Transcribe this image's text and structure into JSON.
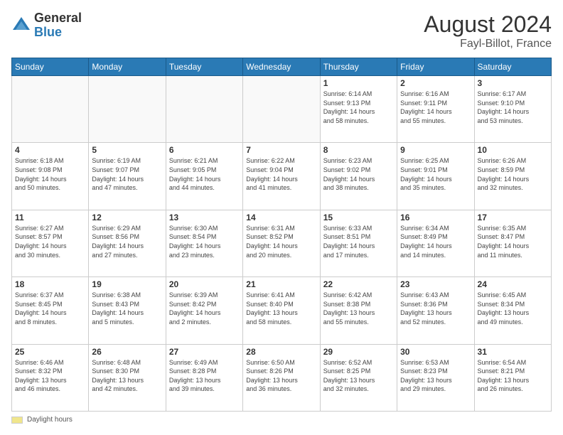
{
  "logo": {
    "general": "General",
    "blue": "Blue"
  },
  "header": {
    "month_year": "August 2024",
    "location": "Fayl-Billot, France"
  },
  "days_of_week": [
    "Sunday",
    "Monday",
    "Tuesday",
    "Wednesday",
    "Thursday",
    "Friday",
    "Saturday"
  ],
  "legend": {
    "label": "Daylight hours"
  },
  "weeks": [
    [
      {
        "day": "",
        "info": ""
      },
      {
        "day": "",
        "info": ""
      },
      {
        "day": "",
        "info": ""
      },
      {
        "day": "",
        "info": ""
      },
      {
        "day": "1",
        "info": "Sunrise: 6:14 AM\nSunset: 9:13 PM\nDaylight: 14 hours\nand 58 minutes."
      },
      {
        "day": "2",
        "info": "Sunrise: 6:16 AM\nSunset: 9:11 PM\nDaylight: 14 hours\nand 55 minutes."
      },
      {
        "day": "3",
        "info": "Sunrise: 6:17 AM\nSunset: 9:10 PM\nDaylight: 14 hours\nand 53 minutes."
      }
    ],
    [
      {
        "day": "4",
        "info": "Sunrise: 6:18 AM\nSunset: 9:08 PM\nDaylight: 14 hours\nand 50 minutes."
      },
      {
        "day": "5",
        "info": "Sunrise: 6:19 AM\nSunset: 9:07 PM\nDaylight: 14 hours\nand 47 minutes."
      },
      {
        "day": "6",
        "info": "Sunrise: 6:21 AM\nSunset: 9:05 PM\nDaylight: 14 hours\nand 44 minutes."
      },
      {
        "day": "7",
        "info": "Sunrise: 6:22 AM\nSunset: 9:04 PM\nDaylight: 14 hours\nand 41 minutes."
      },
      {
        "day": "8",
        "info": "Sunrise: 6:23 AM\nSunset: 9:02 PM\nDaylight: 14 hours\nand 38 minutes."
      },
      {
        "day": "9",
        "info": "Sunrise: 6:25 AM\nSunset: 9:01 PM\nDaylight: 14 hours\nand 35 minutes."
      },
      {
        "day": "10",
        "info": "Sunrise: 6:26 AM\nSunset: 8:59 PM\nDaylight: 14 hours\nand 32 minutes."
      }
    ],
    [
      {
        "day": "11",
        "info": "Sunrise: 6:27 AM\nSunset: 8:57 PM\nDaylight: 14 hours\nand 30 minutes."
      },
      {
        "day": "12",
        "info": "Sunrise: 6:29 AM\nSunset: 8:56 PM\nDaylight: 14 hours\nand 27 minutes."
      },
      {
        "day": "13",
        "info": "Sunrise: 6:30 AM\nSunset: 8:54 PM\nDaylight: 14 hours\nand 23 minutes."
      },
      {
        "day": "14",
        "info": "Sunrise: 6:31 AM\nSunset: 8:52 PM\nDaylight: 14 hours\nand 20 minutes."
      },
      {
        "day": "15",
        "info": "Sunrise: 6:33 AM\nSunset: 8:51 PM\nDaylight: 14 hours\nand 17 minutes."
      },
      {
        "day": "16",
        "info": "Sunrise: 6:34 AM\nSunset: 8:49 PM\nDaylight: 14 hours\nand 14 minutes."
      },
      {
        "day": "17",
        "info": "Sunrise: 6:35 AM\nSunset: 8:47 PM\nDaylight: 14 hours\nand 11 minutes."
      }
    ],
    [
      {
        "day": "18",
        "info": "Sunrise: 6:37 AM\nSunset: 8:45 PM\nDaylight: 14 hours\nand 8 minutes."
      },
      {
        "day": "19",
        "info": "Sunrise: 6:38 AM\nSunset: 8:43 PM\nDaylight: 14 hours\nand 5 minutes."
      },
      {
        "day": "20",
        "info": "Sunrise: 6:39 AM\nSunset: 8:42 PM\nDaylight: 14 hours\nand 2 minutes."
      },
      {
        "day": "21",
        "info": "Sunrise: 6:41 AM\nSunset: 8:40 PM\nDaylight: 13 hours\nand 58 minutes."
      },
      {
        "day": "22",
        "info": "Sunrise: 6:42 AM\nSunset: 8:38 PM\nDaylight: 13 hours\nand 55 minutes."
      },
      {
        "day": "23",
        "info": "Sunrise: 6:43 AM\nSunset: 8:36 PM\nDaylight: 13 hours\nand 52 minutes."
      },
      {
        "day": "24",
        "info": "Sunrise: 6:45 AM\nSunset: 8:34 PM\nDaylight: 13 hours\nand 49 minutes."
      }
    ],
    [
      {
        "day": "25",
        "info": "Sunrise: 6:46 AM\nSunset: 8:32 PM\nDaylight: 13 hours\nand 46 minutes."
      },
      {
        "day": "26",
        "info": "Sunrise: 6:48 AM\nSunset: 8:30 PM\nDaylight: 13 hours\nand 42 minutes."
      },
      {
        "day": "27",
        "info": "Sunrise: 6:49 AM\nSunset: 8:28 PM\nDaylight: 13 hours\nand 39 minutes."
      },
      {
        "day": "28",
        "info": "Sunrise: 6:50 AM\nSunset: 8:26 PM\nDaylight: 13 hours\nand 36 minutes."
      },
      {
        "day": "29",
        "info": "Sunrise: 6:52 AM\nSunset: 8:25 PM\nDaylight: 13 hours\nand 32 minutes."
      },
      {
        "day": "30",
        "info": "Sunrise: 6:53 AM\nSunset: 8:23 PM\nDaylight: 13 hours\nand 29 minutes."
      },
      {
        "day": "31",
        "info": "Sunrise: 6:54 AM\nSunset: 8:21 PM\nDaylight: 13 hours\nand 26 minutes."
      }
    ]
  ]
}
